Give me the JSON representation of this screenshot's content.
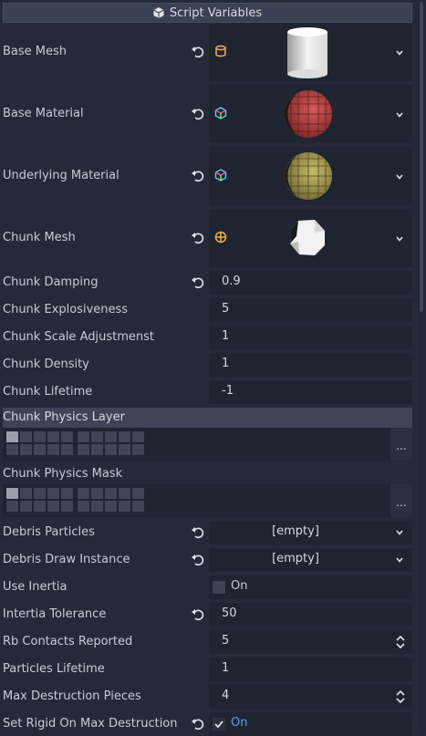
{
  "header": {
    "title": "Script Variables",
    "icon": "script-icon"
  },
  "properties": {
    "base_mesh": {
      "label": "Base Mesh",
      "type_icon": "cylinder-mesh-icon",
      "preview": "cylinder-mesh-preview"
    },
    "base_material": {
      "label": "Base Material",
      "type_icon": "material-icon",
      "preview": "red-sphere-material-preview"
    },
    "underlying_material": {
      "label": "Underlying Material",
      "type_icon": "material-icon",
      "preview": "yellow-sphere-material-preview"
    },
    "chunk_mesh": {
      "label": "Chunk Mesh",
      "type_icon": "mesh-instance-icon",
      "preview": "chunk-mesh-preview"
    },
    "chunk_damping": {
      "label": "Chunk Damping",
      "value": "0.9"
    },
    "chunk_explosiveness": {
      "label": "Chunk Explosiveness",
      "value": "5"
    },
    "chunk_scale_adjustment": {
      "label": "Chunk Scale Adjustmenst",
      "value": "1"
    },
    "chunk_density": {
      "label": "Chunk Density",
      "value": "1"
    },
    "chunk_lifetime": {
      "label": "Chunk Lifetime",
      "value": "-1"
    },
    "chunk_physics_layer": {
      "label": "Chunk Physics Layer",
      "button": "..."
    },
    "chunk_physics_mask": {
      "label": "Chunk Physics Mask",
      "button": "..."
    },
    "debris_particles": {
      "label": "Debris Particles",
      "value": "[empty]"
    },
    "debris_draw_instance": {
      "label": "Debris Draw Instance",
      "value": "[empty]"
    },
    "use_inertia": {
      "label": "Use Inertia",
      "value": "On",
      "checked": false
    },
    "inertia_tolerance": {
      "label": "Intertia Tolerance",
      "value": "50"
    },
    "rb_contacts_reported": {
      "label": "Rb Contacts Reported",
      "value": "5"
    },
    "particles_lifetime": {
      "label": "Particles Lifetime",
      "value": "1"
    },
    "max_destruction_pieces": {
      "label": "Max Destruction Pieces",
      "value": "4"
    },
    "set_rigid_on_max_destruction": {
      "label": "Set Rigid On Max Destruction",
      "value": "On",
      "checked": true
    }
  },
  "colors": {
    "background": "#242a38",
    "field": "#1f2431",
    "header": "#3a4152",
    "on_accent": "#5aa0f0"
  }
}
